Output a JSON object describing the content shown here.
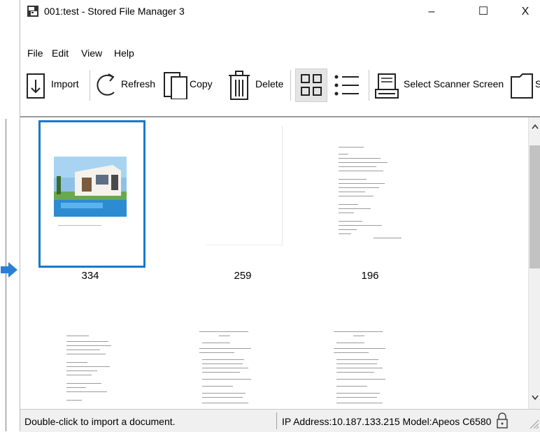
{
  "window": {
    "title": "001:test - Stored File Manager 3",
    "controls": {
      "minimize": "–",
      "maximize": "☐",
      "close": "X"
    }
  },
  "menu": [
    "File",
    "Edit",
    "View",
    "Help"
  ],
  "toolbar": {
    "import_label": "Import",
    "refresh_label": "Refresh",
    "copy_label": "Copy",
    "delete_label": "Delete",
    "select_scanner_label": "Select Scanner Screen",
    "partial_label": "S",
    "view_modes": [
      "thumbnail-view",
      "list-view"
    ],
    "active_view": "thumbnail-view"
  },
  "thumbnails": [
    {
      "label": "334",
      "kind": "photo",
      "selected": true
    },
    {
      "label": "259",
      "kind": "blank",
      "selected": false
    },
    {
      "label": "196",
      "kind": "document",
      "selected": false
    },
    {
      "label": "",
      "kind": "document",
      "selected": false
    },
    {
      "label": "",
      "kind": "document",
      "selected": false
    },
    {
      "label": "",
      "kind": "document",
      "selected": false
    }
  ],
  "status": {
    "hint": "Double-click to import a document.",
    "device": "IP Address:10.187.133.215 Model:Apeos C6580"
  },
  "colors": {
    "selection": "#1a78c8",
    "arrow": "#2a7fd4"
  }
}
